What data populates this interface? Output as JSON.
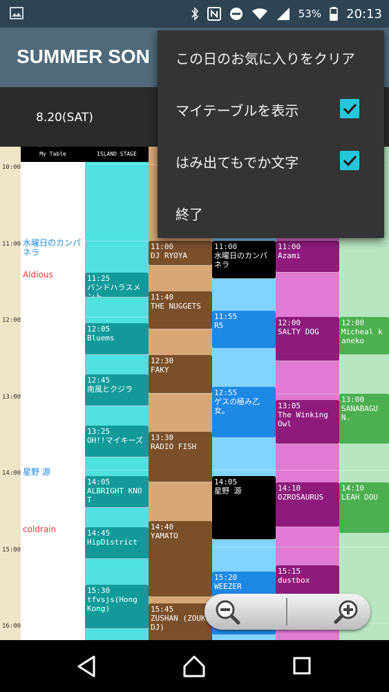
{
  "status_bar": {
    "battery_percent": "53%",
    "time": "20:13",
    "icons": [
      "image-icon",
      "bluetooth-icon",
      "nfc-icon",
      "do-not-disturb-icon",
      "wifi-icon",
      "signal-icon",
      "battery-icon"
    ]
  },
  "app": {
    "title": "SUMMER SON"
  },
  "tabs": [
    {
      "label": "8.20(SAT)"
    }
  ],
  "times": [
    "10:00",
    "11:00",
    "12:00",
    "13:00",
    "14:00",
    "15:00",
    "16:00"
  ],
  "columns": [
    {
      "name": "My Table",
      "bg": "#ffffff"
    },
    {
      "name": "ISLAND STAGE",
      "bg": "#4fe0e0"
    },
    {
      "name": "",
      "bg": "#d9a777"
    },
    {
      "name": "",
      "bg": "#80d4ff"
    },
    {
      "name": "",
      "bg": "#e07ad3"
    },
    {
      "name": "",
      "bg": "#b8e6c0"
    }
  ],
  "my_table": [
    {
      "name": "水曜日のカンパネラ",
      "color": "#1e88e5"
    },
    {
      "name": "Aldious",
      "color": "#e53935"
    },
    {
      "name": "星野 源",
      "color": "#1e88e5"
    },
    {
      "name": "coldrain",
      "color": "#e53935"
    }
  ],
  "island_stage": [
    {
      "time": "11:25",
      "name": "バンドハラスメント"
    },
    {
      "time": "12:05",
      "name": "Bluems"
    },
    {
      "time": "12:45",
      "name": "南風とクジラ"
    },
    {
      "time": "13:25",
      "name": "OH!!マイキーズ"
    },
    {
      "time": "14:05",
      "name": "ALBRIGHT KNOT"
    },
    {
      "time": "14:45",
      "name": "HipDistrict"
    },
    {
      "time": "15:30",
      "name": "tfvsjs(Hong Kong)"
    }
  ],
  "stage3": [
    {
      "time": "11:00",
      "name": "DJ RYOYA"
    },
    {
      "time": "11:40",
      "name": "THE NUGGETS"
    },
    {
      "time": "12:30",
      "name": "FAKY"
    },
    {
      "time": "13:30",
      "name": "RADIO FISH"
    },
    {
      "time": "14:40",
      "name": "YAMATO"
    },
    {
      "time": "15:45",
      "name": "ZUSHAN (ZOUK DJ)"
    }
  ],
  "stage4": [
    {
      "time": "11:00",
      "name": "水曜日のカンパネラ"
    },
    {
      "time": "11:55",
      "name": "R5"
    },
    {
      "time": "12:55",
      "name": "ゲスの極み乙女。"
    },
    {
      "time": "14:05",
      "name": "星野 源"
    },
    {
      "time": "15:20",
      "name": "WEEZER"
    }
  ],
  "stage5": [
    {
      "time": "11:00",
      "name": "Azami"
    },
    {
      "time": "12:00",
      "name": "SALTY DOG"
    },
    {
      "time": "13:05",
      "name": "The Winking Owl"
    },
    {
      "time": "14:10",
      "name": "OZROSAURUS"
    },
    {
      "time": "15:15",
      "name": "dustbox"
    }
  ],
  "stage6": [
    {
      "time": "12:00",
      "name": "Micheal kaneko"
    },
    {
      "time": "13:00",
      "name": "SANABAGUN."
    },
    {
      "time": "14:10",
      "name": "LEAH DOU"
    }
  ],
  "menu": {
    "items": [
      {
        "label": "この日のお気に入りをクリア"
      },
      {
        "label": "マイテーブルを表示",
        "checked": true
      },
      {
        "label": "はみ出てもでか文字",
        "checked": true
      },
      {
        "label": "終了"
      }
    ]
  },
  "colors": {
    "accent": "#26c6da",
    "island_event": "#129a9a",
    "stage3_event": "#7b4f2a",
    "stage4_event_blue": "#1e88e5",
    "stage4_event_black": "#000000",
    "stage5_event": "#8e1b7c",
    "stage6_event": "#4caf50"
  }
}
